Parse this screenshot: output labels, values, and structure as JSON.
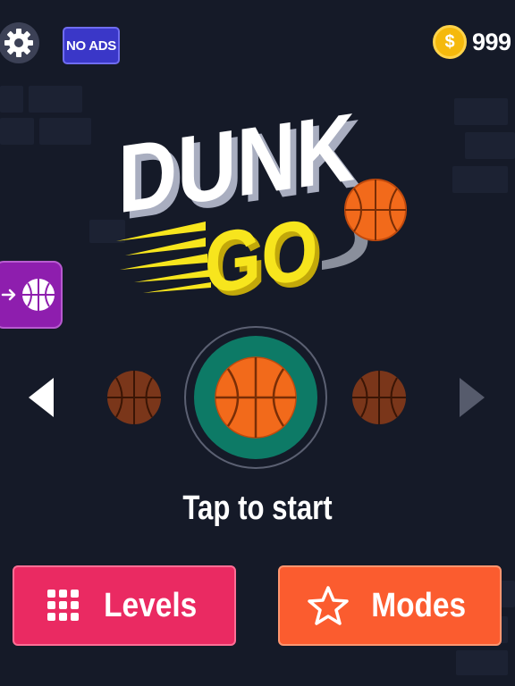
{
  "header": {
    "no_ads_label": "NO ADS",
    "coin_symbol": "$",
    "coin_count": "999"
  },
  "logo": {
    "line1": "DUNK",
    "line2": "GO"
  },
  "ball_selector": {
    "selected_ring_color": "#0d7a66",
    "ball_color": "#f26a1b"
  },
  "start_prompt": "Tap to start",
  "buttons": {
    "levels_label": "Levels",
    "modes_label": "Modes"
  },
  "colors": {
    "background": "#151a28",
    "levels": "#ea2a62",
    "modes": "#fb5c2f",
    "side_tab": "#8e1eae",
    "no_ads": "#3a37c8",
    "logo_yellow": "#f7e51d"
  }
}
